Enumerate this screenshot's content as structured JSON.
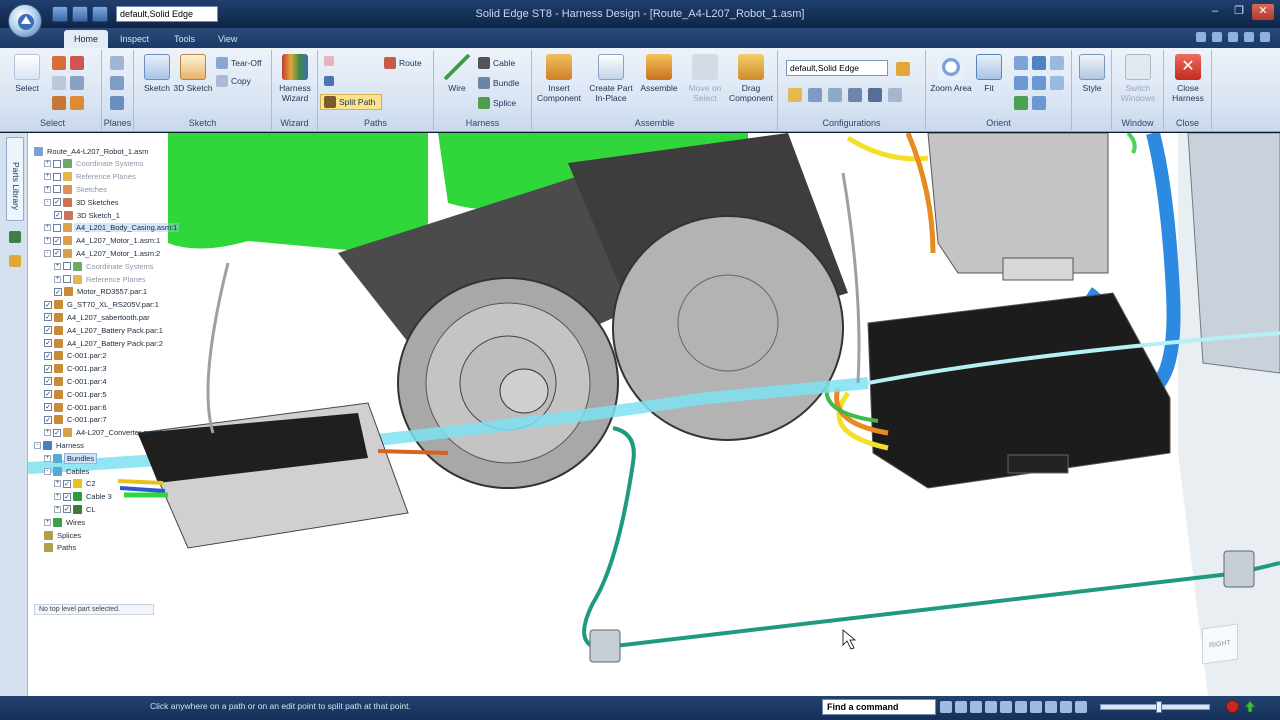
{
  "window": {
    "title": "Solid Edge ST8 - Harness Design - [Route_A4-L207_Robot_1.asm]",
    "qat_config_value": "default,Solid Edge"
  },
  "tabs": [
    {
      "label": "Home",
      "active": true
    },
    {
      "label": "Inspect"
    },
    {
      "label": "Tools"
    },
    {
      "label": "View"
    }
  ],
  "ribbon": {
    "select": {
      "label": "Select",
      "group": "Select"
    },
    "planes": {
      "group": "Planes"
    },
    "sketch": {
      "sketch": "Sketch",
      "sketch3d": "3D Sketch",
      "tearoff": "Tear-Off",
      "copy": "Copy",
      "group": "Sketch"
    },
    "wizard": {
      "harness_wizard": "Harness Wizard",
      "group": "Wizard"
    },
    "paths": {
      "route": "Route",
      "split_path": "Split Path",
      "group": "Paths"
    },
    "harness": {
      "wire": "Wire",
      "cable": "Cable",
      "bundle": "Bundle",
      "splice": "Splice",
      "group": "Harness"
    },
    "assemble": {
      "insert_component": "Insert Component",
      "create_part": "Create Part In-Place",
      "assemble": "Assemble",
      "move_on_select": "Move on Select",
      "drag_component": "Drag Component",
      "group": "Assemble"
    },
    "configurations": {
      "value": "default,Solid Edge",
      "group": "Configurations"
    },
    "orient": {
      "zoom_area": "Zoom Area",
      "fit": "Fit",
      "group": "Orient"
    },
    "style": {
      "label": "Style"
    },
    "window": {
      "switch_windows": "Switch Windows",
      "group": "Window"
    },
    "close": {
      "close_harness": "Close Harness",
      "group": "Close"
    }
  },
  "rail": {
    "tab_label": "Parts Library"
  },
  "tree": [
    {
      "label": "Route_A4-L207_Robot_1.asm",
      "indent": 0,
      "icon": "#7aa0cf",
      "style": "normal"
    },
    {
      "label": "Coordinate Systems",
      "indent": 1,
      "icon": "#6fa86a",
      "style": "dim",
      "exp": "+",
      "chk": ""
    },
    {
      "label": "Reference Planes",
      "indent": 1,
      "icon": "#e2b54e",
      "style": "dim",
      "exp": "+",
      "chk": ""
    },
    {
      "label": "Sketches",
      "indent": 1,
      "icon": "#e09050",
      "style": "dim",
      "exp": "+",
      "chk": ""
    },
    {
      "label": "3D Sketches",
      "indent": 1,
      "icon": "#c9735a",
      "style": "normal",
      "exp": "-",
      "chk": "✓"
    },
    {
      "label": "3D Sketch_1",
      "indent": 2,
      "icon": "#c9735a",
      "style": "normal",
      "chk": "✓"
    },
    {
      "label": "A4_L201_Body_Casing.asm:1",
      "indent": 1,
      "icon": "#d6a04c",
      "style": "hl",
      "exp": "+",
      "chk": ""
    },
    {
      "label": "A4_L207_Motor_1.asm:1",
      "indent": 1,
      "icon": "#d6a04c",
      "style": "normal",
      "exp": "+",
      "chk": "✓"
    },
    {
      "label": "A4_L207_Motor_1.asm:2",
      "indent": 1,
      "icon": "#d6a04c",
      "style": "normal",
      "exp": "-",
      "chk": "✓"
    },
    {
      "label": "Coordinate Systems",
      "indent": 2,
      "icon": "#6fa86a",
      "style": "dim",
      "exp": "+",
      "chk": ""
    },
    {
      "label": "Reference Planes",
      "indent": 2,
      "icon": "#e2b54e",
      "style": "dim",
      "exp": "+",
      "chk": ""
    },
    {
      "label": "Motor_RD3557.par:1",
      "indent": 2,
      "icon": "#c98a3a",
      "style": "normal",
      "chk": "✓"
    },
    {
      "label": "G_ST70_XL_RS205V.par:1",
      "indent": 1,
      "icon": "#c98a3a",
      "style": "normal",
      "chk": "✓"
    },
    {
      "label": "A4_L207_sabertooth.par",
      "indent": 1,
      "icon": "#c98a3a",
      "style": "normal",
      "chk": "✓"
    },
    {
      "label": "A4_L207_Battery Pack.par:1",
      "indent": 1,
      "icon": "#c98a3a",
      "style": "normal",
      "chk": "✓"
    },
    {
      "label": "A4_L207_Battery Pack.par:2",
      "indent": 1,
      "icon": "#c98a3a",
      "style": "normal",
      "chk": "✓"
    },
    {
      "label": "C-001.par:2",
      "indent": 1,
      "icon": "#c98a3a",
      "style": "normal",
      "chk": "✓"
    },
    {
      "label": "C-001.par:3",
      "indent": 1,
      "icon": "#c98a3a",
      "style": "normal",
      "chk": "✓"
    },
    {
      "label": "C-001.par:4",
      "indent": 1,
      "icon": "#c98a3a",
      "style": "normal",
      "chk": "✓"
    },
    {
      "label": "C-001.par:5",
      "indent": 1,
      "icon": "#c98a3a",
      "style": "normal",
      "chk": "✓"
    },
    {
      "label": "C-001.par:6",
      "indent": 1,
      "icon": "#c98a3a",
      "style": "normal",
      "chk": "✓"
    },
    {
      "label": "C-001.par:7",
      "indent": 1,
      "icon": "#c98a3a",
      "style": "normal",
      "chk": "✓"
    },
    {
      "label": "A4-L207_Converter.asm:1",
      "indent": 1,
      "icon": "#d6a04c",
      "style": "normal",
      "exp": "+",
      "chk": "✓"
    },
    {
      "label": "Harness",
      "indent": 0,
      "icon": "#4d7fc0",
      "style": "normal",
      "exp": "-"
    },
    {
      "label": "Bundles",
      "indent": 1,
      "icon": "#5aa7d8",
      "style": "sel",
      "exp": "+"
    },
    {
      "label": "Cables",
      "indent": 1,
      "icon": "#5aa7d8",
      "style": "normal",
      "exp": "-"
    },
    {
      "label": "C2",
      "indent": 2,
      "icon": "#e6c21c",
      "style": "normal",
      "exp": "+",
      "chk": "✓"
    },
    {
      "label": "Cable 3",
      "indent": 2,
      "icon": "#2c9c3c",
      "style": "normal",
      "exp": "+",
      "chk": "✓"
    },
    {
      "label": "CL",
      "indent": 2,
      "icon": "#3c7a3a",
      "style": "normal",
      "exp": "+",
      "chk": "✓"
    },
    {
      "label": "Wires",
      "indent": 1,
      "icon": "#3aa04a",
      "style": "normal",
      "exp": "+"
    },
    {
      "label": "Splices",
      "indent": 1,
      "icon": "#b0a04a",
      "style": "normal"
    },
    {
      "label": "Paths",
      "indent": 1,
      "icon": "#b0a04a",
      "style": "normal"
    }
  ],
  "tree_status": "No top level part selected.",
  "viewcube_label": "RIGHT",
  "status": {
    "message": "Click anywhere on a path or on an edit point to split path at that point.",
    "find_command": "Find a command",
    "zoom_fraction": 0.53
  }
}
